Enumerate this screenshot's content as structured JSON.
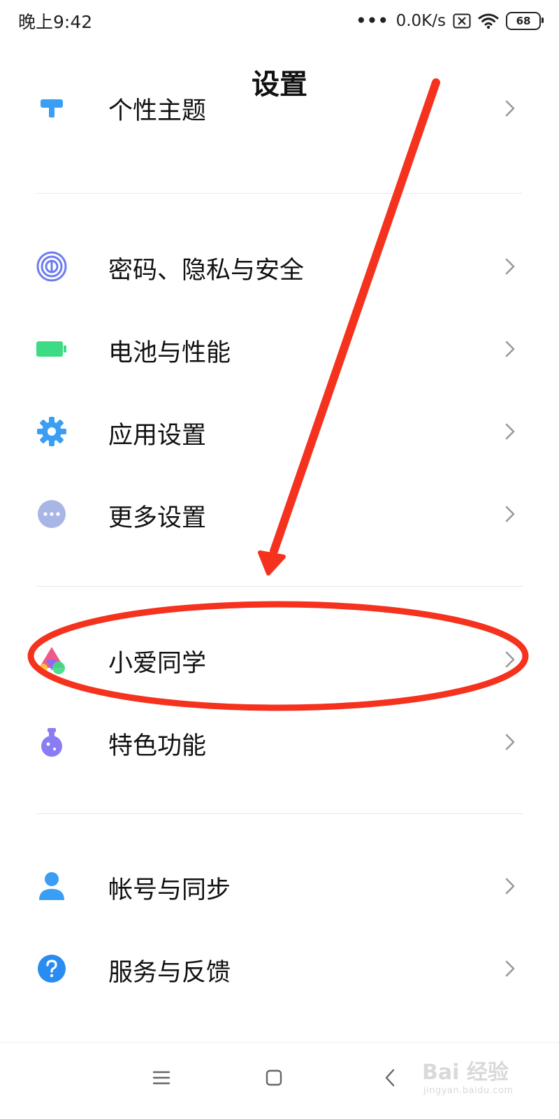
{
  "status_bar": {
    "time": "晚上9:42",
    "network_speed": "0.0K/s",
    "battery_level": "68",
    "icons": [
      "signal-dots-icon",
      "sim-card-x-icon",
      "wifi-icon",
      "battery-icon"
    ]
  },
  "header": {
    "title": "设置"
  },
  "partial_item": {
    "label": "个性主题",
    "icon": "theme-brush-icon"
  },
  "groups": [
    {
      "items": [
        {
          "label": "密码、隐私与安全",
          "icon": "fingerprint-icon",
          "color": "#6c7cf0"
        },
        {
          "label": "电池与性能",
          "icon": "battery-green-icon",
          "color": "#3ddc84"
        },
        {
          "label": "应用设置",
          "icon": "gear-icon",
          "color": "#3a9ef5"
        },
        {
          "label": "更多设置",
          "icon": "more-dots-icon",
          "color": "#a8b6e6"
        }
      ]
    },
    {
      "items": [
        {
          "label": "小爱同学",
          "icon": "xiaoai-icon",
          "color": "#f05a8a"
        },
        {
          "label": "特色功能",
          "icon": "flask-icon",
          "color": "#8a7cf5"
        }
      ]
    },
    {
      "items": [
        {
          "label": "帐号与同步",
          "icon": "user-icon",
          "color": "#3a9ef5"
        },
        {
          "label": "服务与反馈",
          "icon": "help-icon",
          "color": "#2a8cf0"
        }
      ]
    }
  ],
  "annotation": {
    "color": "#f5321e",
    "shapes": [
      "arrow",
      "ellipse"
    ]
  },
  "nav_bar": {
    "icons": [
      "menu-icon",
      "home-square-icon",
      "back-icon"
    ]
  },
  "watermark": {
    "main": "Bai 经验",
    "url": "jingyan.baidu.com"
  }
}
